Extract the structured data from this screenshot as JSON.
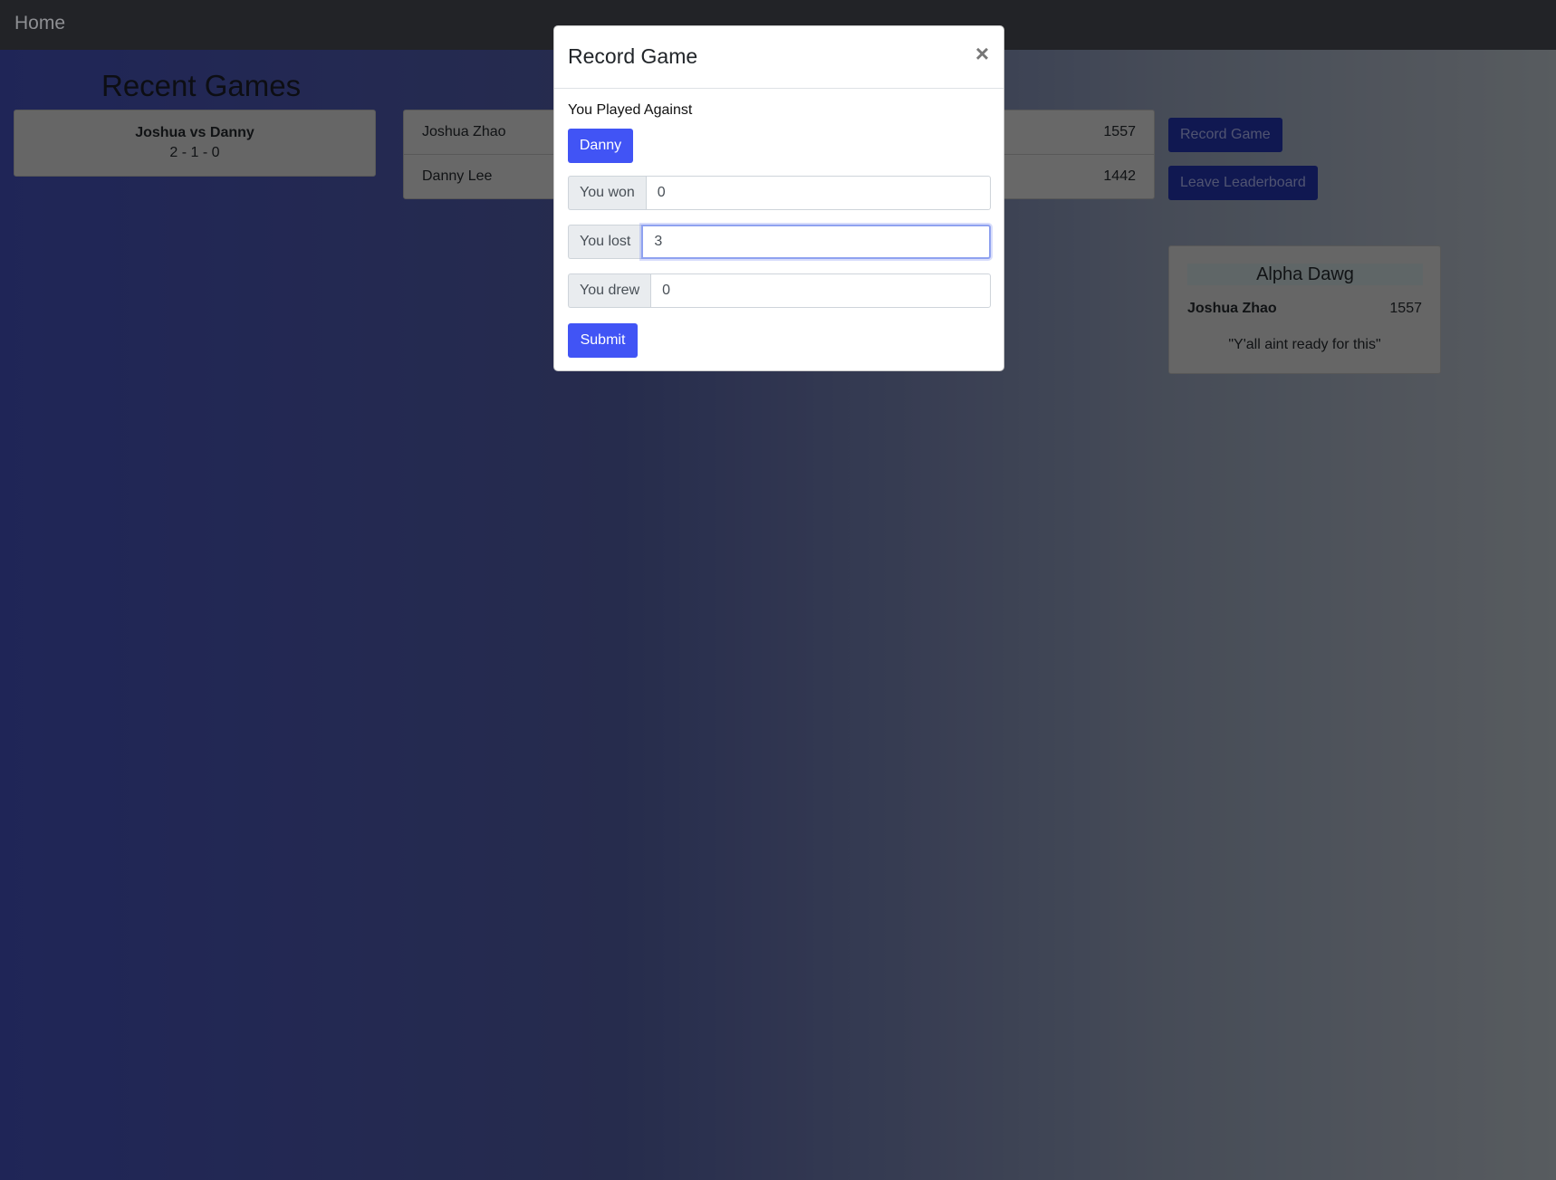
{
  "navbar": {
    "home_label": "Home"
  },
  "recent_games": {
    "title": "Recent Games",
    "games": [
      {
        "title": "Joshua vs Danny",
        "score": "2 - 1 - 0"
      }
    ]
  },
  "leaderboard": {
    "rows": [
      {
        "name": "Joshua Zhao",
        "score": "1557"
      },
      {
        "name": "Danny Lee",
        "score": "1442"
      }
    ]
  },
  "actions": {
    "record_game_label": "Record Game",
    "leave_leaderboard_label": "Leave Leaderboard"
  },
  "champion": {
    "title": "Alpha Dawg",
    "name": "Joshua Zhao",
    "score": "1557",
    "quote": "\"Y'all aint ready for this\""
  },
  "modal": {
    "title": "Record Game",
    "close_glyph": "×",
    "against_label": "You Played Against",
    "opponent": "Danny",
    "fields": {
      "won": {
        "label": "You won",
        "value": "0"
      },
      "lost": {
        "label": "You lost",
        "value": "3"
      },
      "drew": {
        "label": "You drew",
        "value": "0"
      }
    },
    "submit_label": "Submit"
  },
  "colors": {
    "primary": "#4154f5",
    "navbar": "#222327"
  }
}
